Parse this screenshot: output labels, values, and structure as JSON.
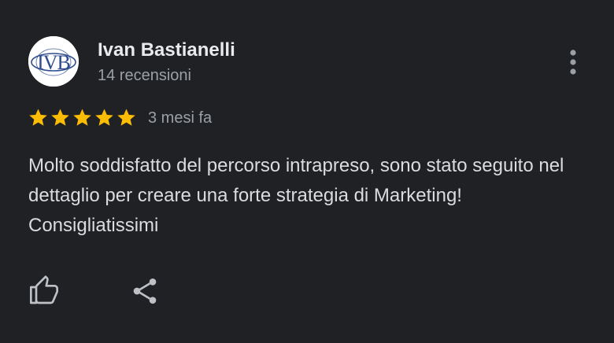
{
  "reviewer": {
    "name": "Ivan Bastianelli",
    "review_count": "14 recensioni",
    "avatar_logo_text": "IVB"
  },
  "rating": {
    "stars": 5,
    "max_stars": 5,
    "star_color": "#fbbc04"
  },
  "time_ago": "3 mesi fa",
  "review_text": "Molto soddisfatto del percorso intrapreso, sono stato seguito nel dettaglio per creare una forte strategia di Marketing! Consigliatissimi",
  "icons": {
    "menu": "more-vert-icon",
    "like": "thumb-up-icon",
    "share": "share-icon"
  },
  "colors": {
    "background": "#202124",
    "primary_text": "#e8eaed",
    "secondary_text": "#9aa0a6",
    "logo_blue": "#2f4d8e"
  }
}
